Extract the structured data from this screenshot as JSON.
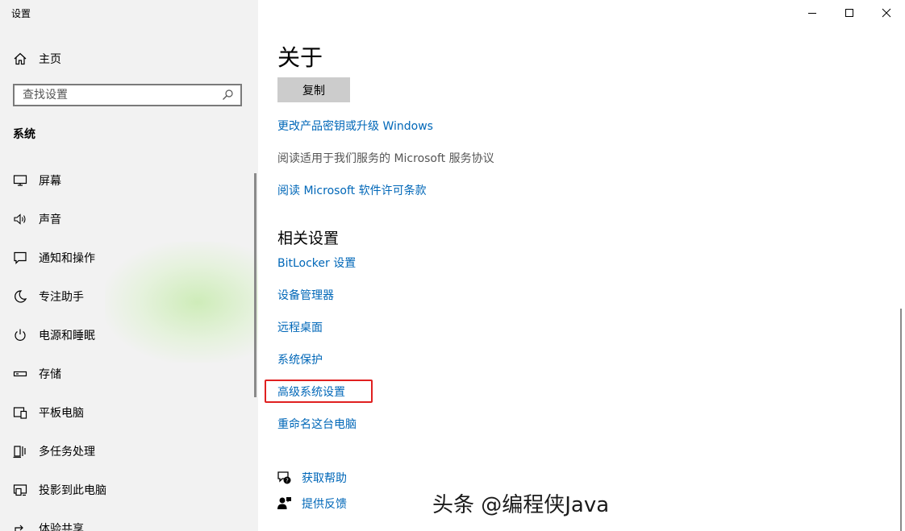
{
  "window": {
    "title": "设置",
    "controls": {
      "minimize_icon": "minimize-icon",
      "maximize_icon": "maximize-icon",
      "close_icon": "close-icon"
    }
  },
  "sidebar": {
    "home_label": "主页",
    "search": {
      "placeholder": "查找设置",
      "value": ""
    },
    "section_title": "系统",
    "items": [
      {
        "label": "屏幕",
        "icon": "monitor-icon"
      },
      {
        "label": "声音",
        "icon": "speaker-icon"
      },
      {
        "label": "通知和操作",
        "icon": "notification-icon"
      },
      {
        "label": "专注助手",
        "icon": "moon-icon"
      },
      {
        "label": "电源和睡眠",
        "icon": "power-icon"
      },
      {
        "label": "存储",
        "icon": "storage-icon"
      },
      {
        "label": "平板电脑",
        "icon": "tablet-icon"
      },
      {
        "label": "多任务处理",
        "icon": "multitask-icon"
      },
      {
        "label": "投影到此电脑",
        "icon": "project-icon"
      },
      {
        "label": "体验共享",
        "icon": "share-icon"
      }
    ]
  },
  "main": {
    "page_title": "关于",
    "copy_button": "复制",
    "links_top": {
      "change_key": "更改产品密钥或升级 Windows",
      "service_agreement": "阅读适用于我们服务的 Microsoft 服务协议",
      "license_terms": "阅读 Microsoft 软件许可条款"
    },
    "related_settings": {
      "title": "相关设置",
      "items": [
        "BitLocker 设置",
        "设备管理器",
        "远程桌面",
        "系统保护",
        "高级系统设置",
        "重命名这台电脑"
      ]
    },
    "help": {
      "get_help": "获取帮助",
      "feedback": "提供反馈"
    }
  },
  "colors": {
    "link": "#0067b8",
    "sidebar_bg": "#f2f2f2",
    "highlight": "#e02020",
    "button_bg": "#cccccc"
  },
  "watermark": "头条 @编程侠Java"
}
